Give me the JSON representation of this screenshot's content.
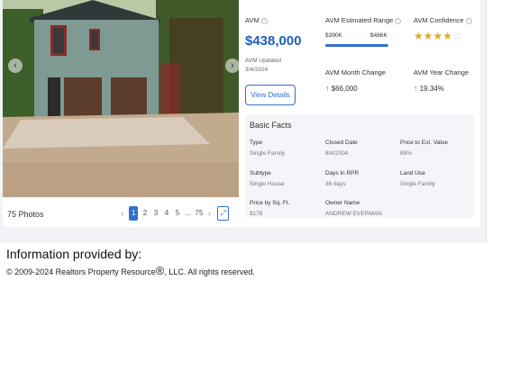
{
  "gallery": {
    "photos_count": "75 Photos",
    "pages": [
      "1",
      "2",
      "3",
      "4",
      "5",
      "...",
      "75"
    ],
    "active_page": "1",
    "prev_icon": "chevron-left-icon",
    "next_icon": "chevron-right-icon",
    "expand_icon": "expand-icon"
  },
  "avm": {
    "label": "AVM",
    "value": "$438,000",
    "updated_label": "AVM Updated",
    "updated_date": "3/4/2024",
    "range_label": "AVM Estimated Range",
    "range_low": "$390K",
    "range_high": "$486K",
    "confidence_label": "AVM Confidence",
    "confidence_stars": 4,
    "confidence_max": 5,
    "month_change_label": "AVM Month Change",
    "month_change_value": "$66,000",
    "year_change_label": "AVM Year Change",
    "year_change_value": "19.34%",
    "view_details_label": "View Details"
  },
  "facts": {
    "title": "Basic Facts",
    "items": [
      {
        "label": "Type",
        "value": "Single Family"
      },
      {
        "label": "Closed Date",
        "value": "8/4/2004"
      },
      {
        "label": "Price to Est. Value",
        "value": "89%"
      },
      {
        "label": "Subtype",
        "value": "Single House"
      },
      {
        "label": "Days in RPR",
        "value": "36 days"
      },
      {
        "label": "Land Use",
        "value": "Single Family"
      },
      {
        "label": "Price by Sq. Ft.",
        "value": "$178"
      },
      {
        "label": "Owner Name",
        "value": "ANDREW EVERMAN"
      }
    ]
  },
  "footer": {
    "info_provided": "Information provided by:",
    "copyright_prefix": "© 2009-2024 Realtors Property Resource",
    "copyright_reg": "®",
    "copyright_suffix": ", LLC. All rights reserved."
  },
  "colors": {
    "accent": "#2f6fd1",
    "value": "#1f5fb8",
    "positive": "#2aa05a",
    "star": "#e5a823"
  }
}
